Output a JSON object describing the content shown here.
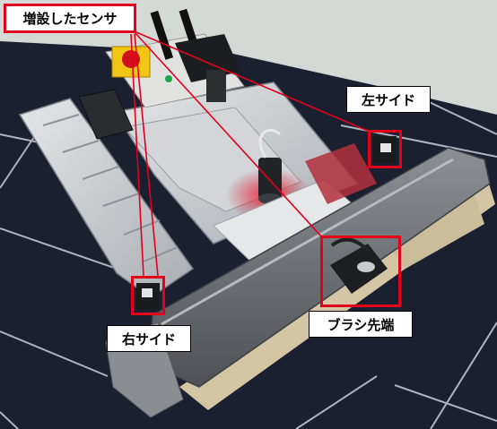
{
  "annotations": {
    "added_sensor": "増設したセンサ",
    "left_side": "左サイド",
    "brush_tip": "ブラシ先端",
    "right_side": "右サイド"
  },
  "colors": {
    "annotation_red": "#e3001b",
    "panel_dark": "#1b2030",
    "wall_gray": "#d5d9d6"
  }
}
